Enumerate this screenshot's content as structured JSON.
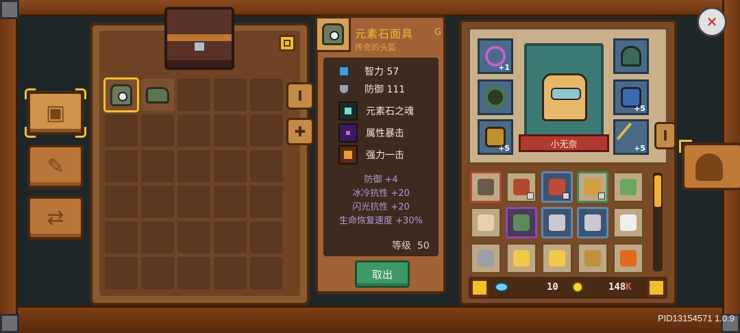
{
  "colors": {
    "accent_gold": "#f2c12e",
    "legendary_name": "#f0b83a",
    "bonus_text": "#b29ad8",
    "take_out_button": "#3e9a64",
    "ribbon": "#b03a2e"
  },
  "side_tabs": [
    {
      "name": "storage",
      "icon": "chest-icon",
      "active": true
    },
    {
      "name": "blueprint",
      "icon": "scroll-map-icon",
      "active": false
    },
    {
      "name": "exchange",
      "icon": "chest-swap-icon",
      "active": false
    }
  ],
  "storage": {
    "pull_tabs": [
      {
        "label": "I",
        "icon": "info-icon"
      },
      {
        "label": "✚",
        "icon": "plus-icon"
      }
    ],
    "items": [
      {
        "icon": "elemental-mask-icon",
        "selected": true
      },
      {
        "icon": "green-boots-icon",
        "selected": false
      }
    ],
    "columns": 5,
    "rows": 6
  },
  "item_detail": {
    "name": "元素石面具",
    "grade": "G",
    "subtitle": "传奇的头盔",
    "stats": [
      {
        "icon": "intelligence-book-icon",
        "label": "智力",
        "value": "57"
      },
      {
        "icon": "defense-shield-icon",
        "label": "防御",
        "value": "111"
      }
    ],
    "skills": [
      {
        "icon": "spirit-orb-icon",
        "label": "元素石之魂"
      },
      {
        "icon": "element-crit-icon",
        "label": "属性暴击"
      },
      {
        "icon": "power-strike-icon",
        "label": "强力一击"
      }
    ],
    "bonuses": [
      "防御 +4",
      "冰冷抗性 +20",
      "闪光抗性 +20",
      "生命恢复速度 +30%"
    ],
    "level_label": "等级",
    "level_value": "50",
    "take_out_label": "取出"
  },
  "character": {
    "name": "小无奈",
    "left_slots": [
      {
        "icon": "purple-necklace-icon",
        "plus": "+1"
      },
      {
        "icon": "green-ring-icon",
        "plus": ""
      },
      {
        "icon": "gold-bracer-icon",
        "plus": "+5"
      }
    ],
    "right_slots": [
      {
        "icon": "green-hood-icon",
        "plus": ""
      },
      {
        "icon": "blue-armor-icon",
        "plus": "+5"
      },
      {
        "icon": "golden-staff-icon",
        "plus": "+5"
      }
    ],
    "info_tab_label": "I"
  },
  "materials": [
    {
      "icon": "leather-boots-icon",
      "style": "red",
      "locked": false
    },
    {
      "icon": "red-helmet-icon",
      "style": "",
      "locked": true
    },
    {
      "icon": "red-boots-icon",
      "style": "blue",
      "locked": true
    },
    {
      "icon": "gold-armor-icon",
      "style": "green",
      "locked": true
    },
    {
      "icon": "green-card-icon",
      "style": "",
      "locked": false
    },
    {
      "icon": "parchment-icon",
      "style": "",
      "locked": false
    },
    {
      "icon": "green-swirl-icon",
      "style": "purple",
      "locked": false
    },
    {
      "icon": "bone-icon",
      "style": "blue",
      "locked": false
    },
    {
      "icon": "bone-icon",
      "style": "blue",
      "locked": false
    },
    {
      "icon": "feather-icon",
      "style": "",
      "locked": false
    },
    {
      "icon": "silver-emblem-icon",
      "style": "",
      "locked": false
    },
    {
      "icon": "gold-bar-icon",
      "style": "",
      "locked": false
    },
    {
      "icon": "gold-bar-icon",
      "style": "",
      "locked": false
    },
    {
      "icon": "wheat-icon",
      "style": "",
      "locked": false
    },
    {
      "icon": "pumpkin-icon",
      "style": "",
      "locked": false
    }
  ],
  "currency": {
    "gems": "10",
    "coins": "148",
    "coins_suffix": "K"
  },
  "build_id": "PID13154571 1.0.9"
}
